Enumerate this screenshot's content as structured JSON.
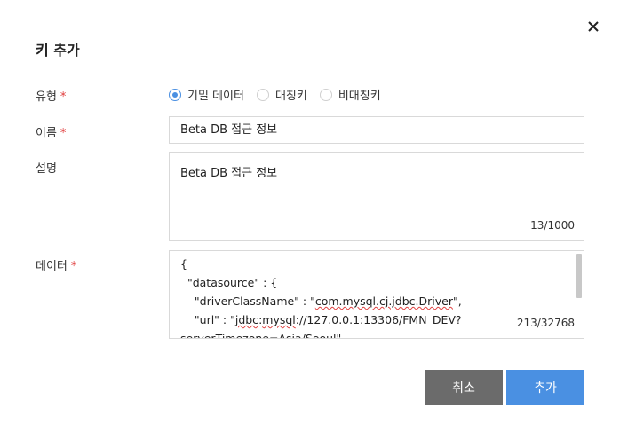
{
  "dialog": {
    "title": "키 추가",
    "close_icon": "close-icon"
  },
  "form": {
    "type": {
      "label": "유형",
      "required_mark": "*",
      "options": [
        {
          "label": "기밀 데이터",
          "selected": true
        },
        {
          "label": "대칭키",
          "selected": false
        },
        {
          "label": "비대칭키",
          "selected": false
        }
      ]
    },
    "name": {
      "label": "이름",
      "required_mark": "*",
      "value": "Beta DB 접근 정보"
    },
    "description": {
      "label": "설명",
      "value": "Beta DB 접근 정보",
      "counter": "13/1000"
    },
    "data": {
      "label": "데이터",
      "required_mark": "*",
      "lines": [
        "{",
        "  \"datasource\" : {",
        "    \"driverClassName\" : \"",
        "com.mysql.cj.jdbc.Driver",
        "\",",
        "    \"url\" : \"",
        "jdbc",
        ":",
        "mysql",
        "://127.0.0.1:13306/FMN_DEV?",
        "serverTimezone=Asia/Seoul\","
      ],
      "counter": "213/32768"
    }
  },
  "buttons": {
    "cancel_label": "취소",
    "add_label": "추가"
  },
  "colors": {
    "accent": "#4a90e2",
    "cancel": "#6b6b6b",
    "required": "#e03a3a"
  }
}
